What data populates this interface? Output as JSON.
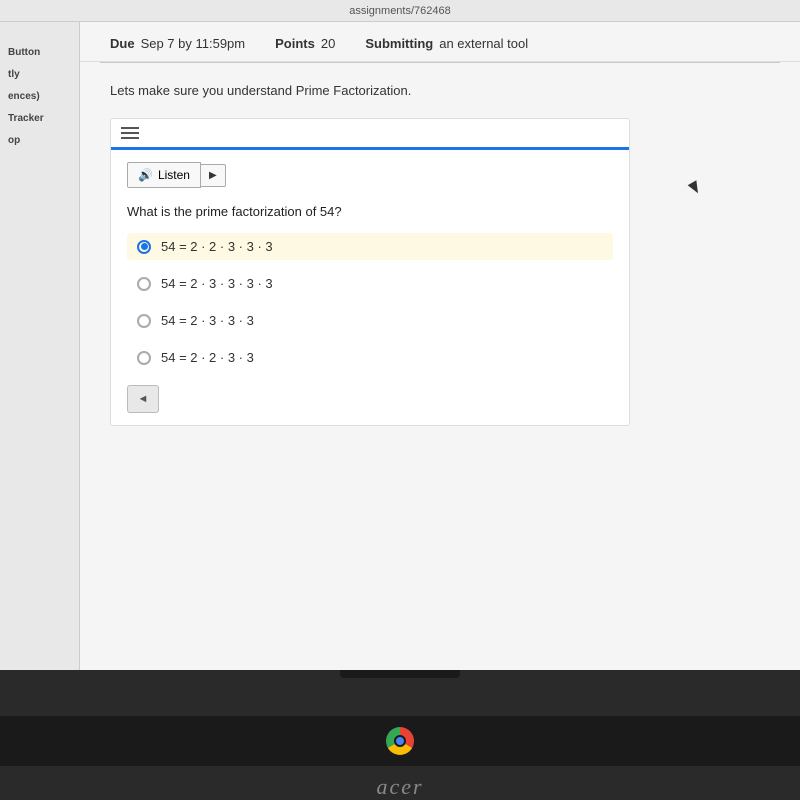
{
  "url_bar": {
    "text": "assignments/762468"
  },
  "header": {
    "due_label": "Due",
    "due_value": "Sep 7 by 11:59pm",
    "points_label": "Points",
    "points_value": "20",
    "submitting_label": "Submitting",
    "submitting_value": "an external tool"
  },
  "sidebar": {
    "items": [
      {
        "label": "Button"
      },
      {
        "label": "tly"
      },
      {
        "label": "ences)"
      },
      {
        "label": "Tracker"
      },
      {
        "label": "op"
      }
    ]
  },
  "intro": {
    "text": "Lets make sure you understand Prime Factorization."
  },
  "listen_btn": {
    "label": "Listen"
  },
  "question": {
    "text": "What is the prime factorization of 54?"
  },
  "options": [
    {
      "id": 1,
      "text": "54 = 2 · 2 · 3 · 3 · 3",
      "selected": true
    },
    {
      "id": 2,
      "text": "54 = 2 · 3 · 3 · 3 · 3",
      "selected": false
    },
    {
      "id": 3,
      "text": "54 = 2 · 3 · 3 · 3",
      "selected": false
    },
    {
      "id": 4,
      "text": "54 = 2 · 2 · 3 · 3",
      "selected": false
    }
  ],
  "nav": {
    "back_icon": "◄"
  },
  "brand": {
    "text": "acer"
  }
}
